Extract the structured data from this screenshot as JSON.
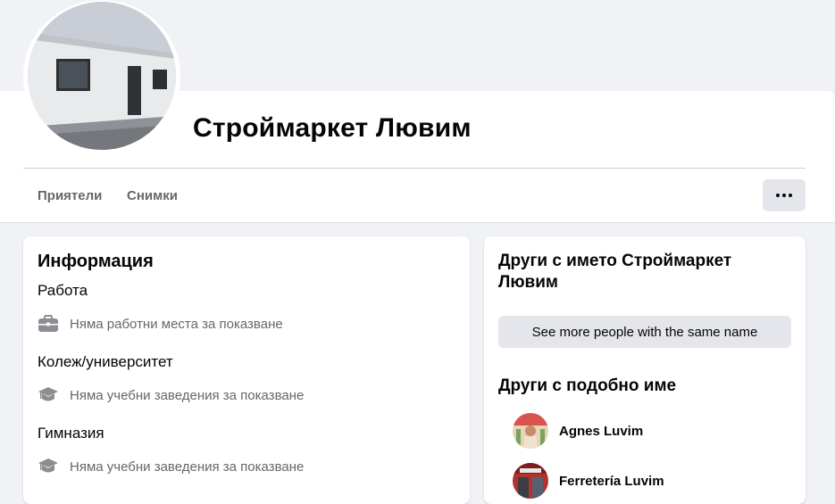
{
  "profile": {
    "name": "Строймаркет Лювим"
  },
  "tabs": [
    {
      "label": "Приятели"
    },
    {
      "label": "Снимки"
    }
  ],
  "info": {
    "title": "Информация",
    "sections": [
      {
        "label": "Работа",
        "icon": "briefcase-icon",
        "text": "Няма работни места за показване"
      },
      {
        "label": "Колеж/университет",
        "icon": "graduation-cap-icon",
        "text": "Няма учебни заведения за показване"
      },
      {
        "label": "Гимназия",
        "icon": "graduation-cap-icon",
        "text": "Няма учебни заведения за показване"
      }
    ]
  },
  "others": {
    "same_name_title": "Други с името Строймаркет Лювим",
    "see_more_label": "See more people with the same name",
    "similar_title": "Други с подобно име",
    "people": [
      {
        "name": "Agnes Luvim"
      },
      {
        "name": "Ferretería Luvim"
      }
    ]
  }
}
